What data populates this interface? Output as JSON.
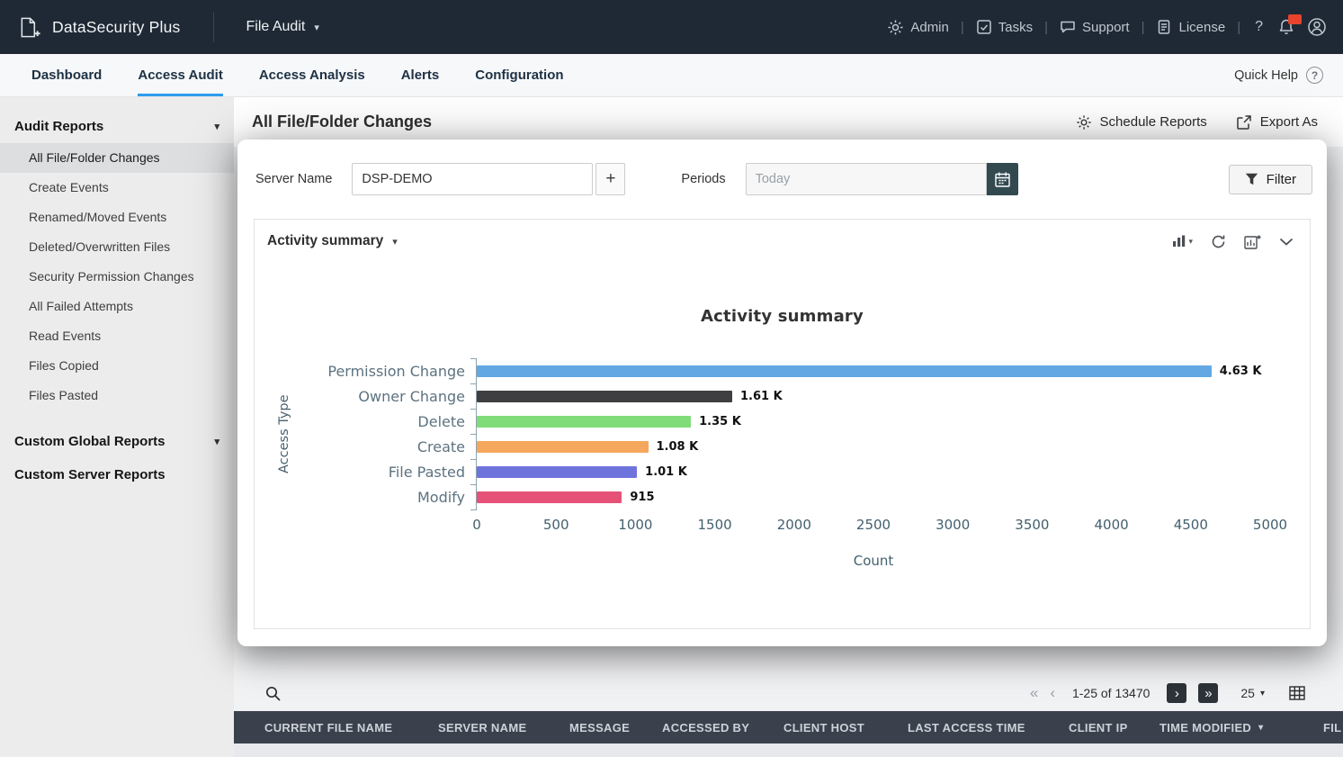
{
  "colors": {
    "accent": "#2d9cf0",
    "topbar_bg": "#1f2935",
    "table_header_bg": "#3a414c",
    "calendar_btn_bg": "#334950",
    "sidebar_bg": "#ececec"
  },
  "icons": {
    "caret_down": "▾",
    "pipe": "|",
    "help": "?",
    "first_page": "«",
    "prev_page": "‹",
    "next_page": "›",
    "last_page": "»"
  },
  "topbar": {
    "brand": "DataSecurity Plus",
    "module": "File Audit",
    "links": [
      {
        "label": "Admin"
      },
      {
        "label": "Tasks"
      },
      {
        "label": "Support"
      },
      {
        "label": "License"
      }
    ]
  },
  "tabs": {
    "items": [
      {
        "label": "Dashboard"
      },
      {
        "label": "Access Audit"
      },
      {
        "label": "Access Analysis"
      },
      {
        "label": "Alerts"
      },
      {
        "label": "Configuration"
      }
    ],
    "active": "Access Audit",
    "quick_help": "Quick Help"
  },
  "sidebar": {
    "sections": [
      {
        "title": "Audit Reports",
        "items": [
          "All File/Folder Changes",
          "Create Events",
          "Renamed/Moved Events",
          "Deleted/Overwritten Files",
          "Security Permission Changes",
          "All Failed Attempts",
          "Read Events",
          "Files Copied",
          "Files Pasted"
        ],
        "selected": "All File/Folder Changes"
      },
      {
        "title": "Custom Global Reports",
        "items": []
      },
      {
        "title": "Custom Server Reports",
        "items": []
      }
    ]
  },
  "content_header": {
    "title": "All File/Folder Changes",
    "schedule_label": "Schedule Reports",
    "export_label": "Export As"
  },
  "panel": {
    "server_name_label": "Server Name",
    "server_name_value": "DSP-DEMO",
    "add_button_label": "+",
    "periods_label": "Periods",
    "periods_value": "Today",
    "filter_label": "Filter",
    "report_selector": "Activity summary"
  },
  "chart_data": {
    "type": "bar",
    "orientation": "horizontal",
    "title": "Activity summary",
    "categories": [
      "Permission Change",
      "Owner Change",
      "Delete",
      "Create",
      "File Pasted",
      "Modify"
    ],
    "values": [
      4630,
      1610,
      1350,
      1080,
      1010,
      915
    ],
    "value_labels": [
      "4.63 K",
      "1.61 K",
      "1.35 K",
      "1.08 K",
      "1.01 K",
      "915"
    ],
    "colors": [
      "#64a8e3",
      "#3f3f41",
      "#7fdc78",
      "#f5a85d",
      "#6f74dc",
      "#e65277"
    ],
    "xlabel": "Count",
    "ylabel": "Access Type",
    "xlim": [
      0,
      5000
    ],
    "xticks": [
      0,
      500,
      1000,
      1500,
      2000,
      2500,
      3000,
      3500,
      4000,
      4500,
      5000
    ],
    "legend": false,
    "grid": false
  },
  "table": {
    "pagination": {
      "range": "1-25 of 13470",
      "page_size": "25"
    },
    "columns": [
      "CURRENT FILE NAME",
      "SERVER NAME",
      "MESSAGE",
      "ACCESSED BY",
      "CLIENT HOST",
      "LAST ACCESS TIME",
      "CLIENT IP",
      "TIME MODIFIED",
      "FIL"
    ],
    "sorted_column": "TIME MODIFIED"
  }
}
